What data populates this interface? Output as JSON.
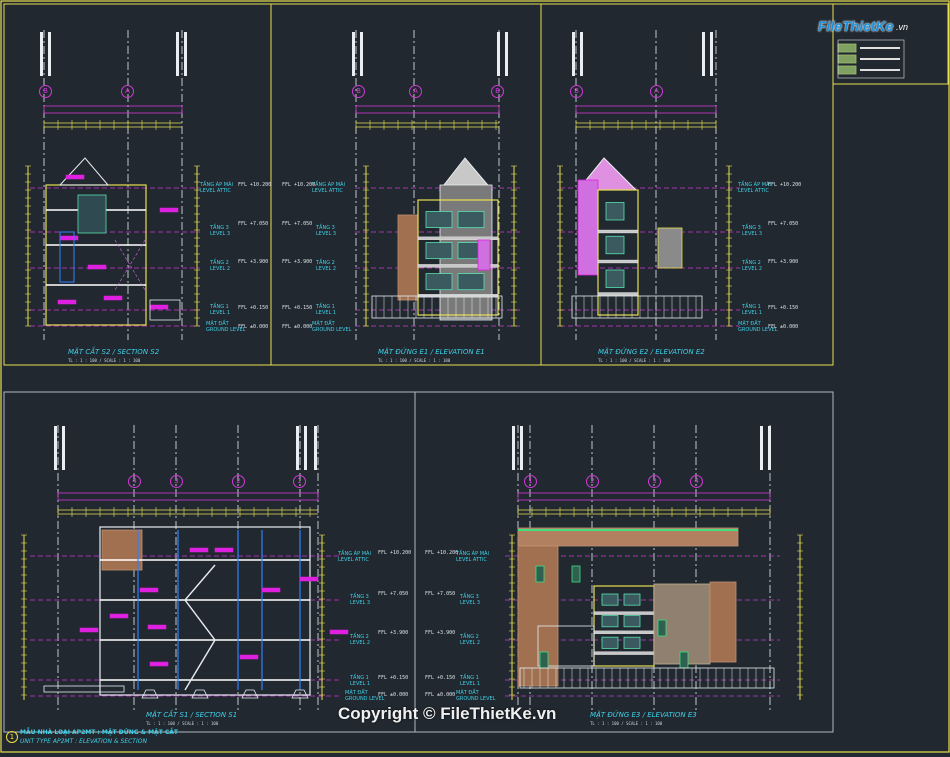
{
  "watermark": "Copyright © FileThietKe.vn",
  "logo": {
    "brand": "FileThietKe",
    "suffix": ".vn"
  },
  "sheet": {
    "title_vn": "MẪU NHÀ LOẠI AP2MT : MẶT ĐỨNG & MẶT CẮT",
    "title_en": "UNIT TYPE AP2MT : ELEVATION & SECTION",
    "number": "1"
  },
  "views": [
    {
      "caption": "MẶT CẮT S2 / SECTION S2",
      "scale": "TL : 1 : 100 / SCALE : 1 : 100"
    },
    {
      "caption": "MẶT ĐỨNG E1 / ELEVATION E1",
      "scale": "TL : 1 : 100 / SCALE : 1 : 100"
    },
    {
      "caption": "MẶT ĐỨNG E2 / ELEVATION E2",
      "scale": "TL : 1 : 100 / SCALE : 1 : 100"
    },
    {
      "caption": "MẶT CẮT S1 / SECTION S1",
      "scale": "TL : 1 : 100 / SCALE : 1 : 100"
    },
    {
      "caption": "MẶT ĐỨNG E3 / ELEVATION E3",
      "scale": "TL : 1 : 100 / SCALE : 1 : 100"
    }
  ],
  "levels": {
    "attic_vn": "TẦNG ÁP MÁI",
    "attic_en": "LEVEL ATTIC",
    "l3_vn": "TẦNG 3",
    "l3_en": "LEVEL 3",
    "l2_vn": "TẦNG 2",
    "l2_en": "LEVEL 2",
    "l1_vn": "TẦNG 1",
    "l1_en": "LEVEL 1",
    "ground_vn": "MẶT ĐẤT",
    "ground_en": "GROUND LEVEL"
  },
  "ffl": {
    "attic": "FFL +10.200",
    "l3": "FFL +7.050",
    "l2": "FFL +3.900",
    "l1": "FFL +0.150",
    "ground": "FFL ±0.000"
  },
  "grid_top": {
    "left": "B",
    "mid": "A",
    "right": "B"
  },
  "grid_bottom_s1": [
    "4",
    "3",
    "2",
    "1"
  ],
  "grid_bottom_e3": [
    "1",
    "2",
    "3",
    "4"
  ],
  "colors": {
    "background": "#212830",
    "frame": "#e8e050",
    "grid": "#d13ad6",
    "text": "#3fd0e6",
    "wall": "#e8e050",
    "glass": "#58e0b0",
    "accent_magenta": "#e020e0"
  }
}
